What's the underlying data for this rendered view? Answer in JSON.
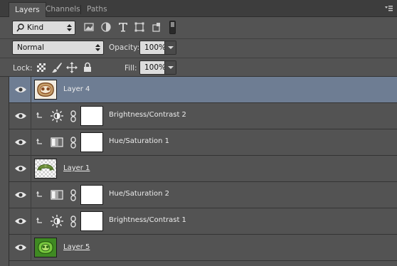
{
  "tabs": [
    {
      "label": "Layers",
      "active": true
    },
    {
      "label": "Channels",
      "active": false
    },
    {
      "label": "Paths",
      "active": false
    }
  ],
  "filter": {
    "kind_label": "Kind",
    "icons": [
      "pixel-filter-icon",
      "adjustment-filter-icon",
      "type-filter-icon",
      "shape-filter-icon",
      "smart-object-filter-icon",
      "filter-toggle-icon"
    ]
  },
  "blend": {
    "mode": "Normal",
    "opacity_label": "Opacity:",
    "opacity_value": "100%"
  },
  "lock": {
    "label": "Lock:",
    "icons": [
      "lock-transparent-icon",
      "lock-image-icon",
      "lock-position-icon",
      "lock-all-icon"
    ],
    "fill_label": "Fill:",
    "fill_value": "100%"
  },
  "layers": [
    {
      "name": "Layer 4",
      "type": "pixel",
      "selected": true,
      "underlined": false,
      "thumb": "ornament-colored"
    },
    {
      "name": "Brightness/Contrast 2",
      "type": "adjustment",
      "adjustment": "brightness-contrast",
      "clipped": true
    },
    {
      "name": "Hue/Saturation 1",
      "type": "adjustment",
      "adjustment": "hue-saturation",
      "clipped": true
    },
    {
      "name": "Layer 1",
      "type": "pixel",
      "underlined": true,
      "thumb": "ornament-transparent"
    },
    {
      "name": "Hue/Saturation 2",
      "type": "adjustment",
      "adjustment": "hue-saturation",
      "clipped": true
    },
    {
      "name": "Brightness/Contrast 1",
      "type": "adjustment",
      "adjustment": "brightness-contrast",
      "clipped": true
    },
    {
      "name": "Layer 5",
      "type": "pixel",
      "underlined": true,
      "thumb": "ornament-green"
    }
  ],
  "colors": {
    "panel_bg": "#535353",
    "selected_row": "#6e7d93",
    "tabbar_bg": "#3d3d3d"
  }
}
